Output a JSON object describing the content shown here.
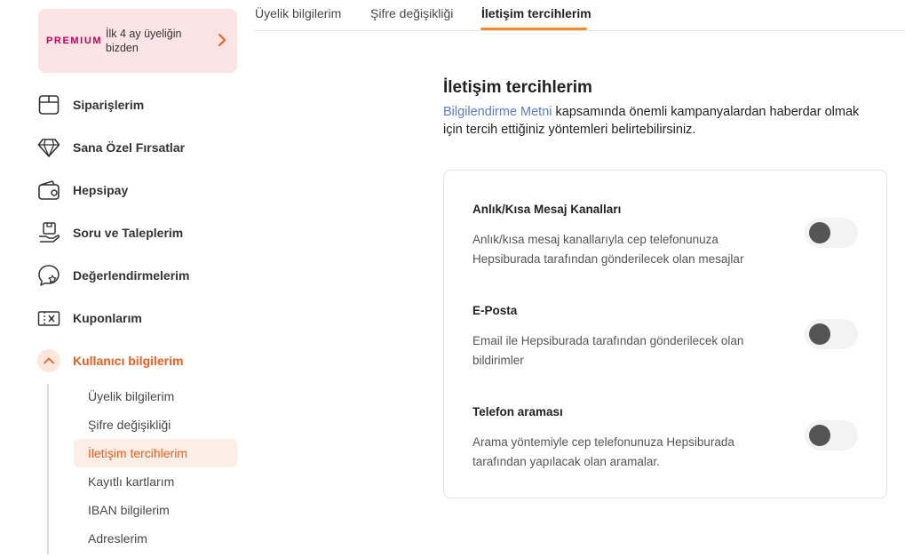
{
  "premium": {
    "logo": "PREMIUM",
    "text": "İlk 4 ay üyeliğin bizden"
  },
  "sidebar": {
    "items": [
      {
        "label": "Siparişlerim",
        "icon": "package-icon"
      },
      {
        "label": "Sana Özel Fırsatlar",
        "icon": "diamond-icon"
      },
      {
        "label": "Hepsipay",
        "icon": "wallet-icon"
      },
      {
        "label": "Soru ve Taleplerim",
        "icon": "support-hand-icon"
      },
      {
        "label": "Değerlendirmelerim",
        "icon": "review-star-icon"
      },
      {
        "label": "Kuponlarım",
        "icon": "coupon-icon"
      },
      {
        "label": "Kullanıcı bilgilerim",
        "icon": "chevron-up-icon",
        "active": true
      }
    ],
    "subitems": [
      {
        "label": "Üyelik bilgilerim"
      },
      {
        "label": "Şifre değişikliği"
      },
      {
        "label": "İletişim tercihlerim",
        "active": true
      },
      {
        "label": "Kayıtlı kartlarım"
      },
      {
        "label": "IBAN bilgilerim"
      },
      {
        "label": "Adreslerim"
      }
    ]
  },
  "tabs": [
    {
      "label": "Üyelik bilgilerim"
    },
    {
      "label": "Şifre değişikliği"
    },
    {
      "label": "İletişim tercihlerim",
      "active": true
    }
  ],
  "main": {
    "title": "İletişim tercihlerim",
    "desc_link": "Bilgilendirme Metni",
    "desc_text": " kapsamında önemli kampanyalardan haberdar olmak için tercih ettiğiniz yöntemleri belirtebilirsiniz."
  },
  "preferences": [
    {
      "title": "Anlık/Kısa Mesaj Kanalları",
      "desc": "Anlık/kısa mesaj kanallarıyla cep telefonunuza Hepsiburada tarafından gönderilecek olan mesajlar",
      "enabled": false
    },
    {
      "title": "E-Posta",
      "desc": "Email ile Hepsiburada tarafından gönderilecek olan bildirimler",
      "enabled": false
    },
    {
      "title": "Telefon araması",
      "desc": "Arama yöntemiyle cep telefonunuza Hepsiburada tarafından yapılacak olan aramalar.",
      "enabled": false
    }
  ],
  "colors": {
    "accent": "#f25c1b",
    "tab_underline": "#f28a2e",
    "premium_bg": "#fde4e4",
    "premium_brand": "#c3005a",
    "link": "#5b7bd6"
  }
}
